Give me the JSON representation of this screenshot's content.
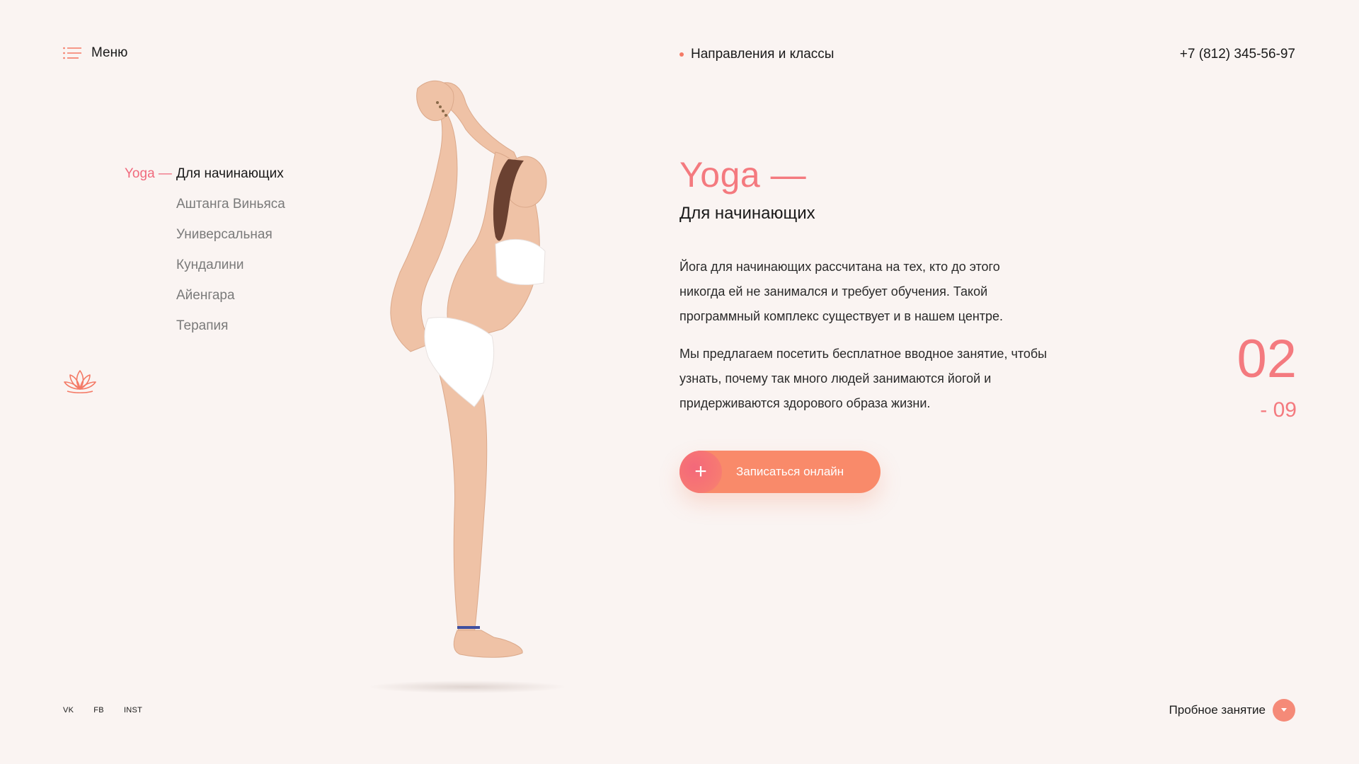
{
  "header": {
    "menu_label": "Меню",
    "nav_center_label": "Направления и классы",
    "phone": "+7 (812) 345-56-97"
  },
  "side_menu": {
    "prefix": "Yoga —",
    "items": [
      {
        "label": "Для начинающих",
        "active": true
      },
      {
        "label": "Аштанга Виньяса",
        "active": false
      },
      {
        "label": "Универсальная",
        "active": false
      },
      {
        "label": "Кундалини",
        "active": false
      },
      {
        "label": "Айенгара",
        "active": false
      },
      {
        "label": "Терапия",
        "active": false
      }
    ]
  },
  "content": {
    "title": "Yoga —",
    "subtitle": "Для начинающих",
    "paragraph_1": "Йога для начинающих рассчитана на тех, кто до этого никогда ей не занимался и требует обучения. Такой программный комплекс существует и в нашем центре.",
    "paragraph_2": "Мы предлагаем посетить бесплатное вводное занятие, чтобы узнать, почему так много людей занимаются йогой и придерживаются здорового образа жизни.",
    "cta_label": "Записаться онлайн",
    "cta_icon": "+"
  },
  "counter": {
    "current": "02",
    "total": "- 09"
  },
  "footer": {
    "socials": [
      "VK",
      "FB",
      "INST"
    ],
    "trial_label": "Пробное занятие"
  },
  "icons": {
    "menu": "menu-lines-icon",
    "lotus": "lotus-icon",
    "trial": "chevron-down-icon"
  },
  "colors": {
    "background": "#faf4f2",
    "accent": "#f47a7f",
    "cta": "#f98a6a",
    "text": "#1a1a1a",
    "muted": "#7a7a7a"
  }
}
